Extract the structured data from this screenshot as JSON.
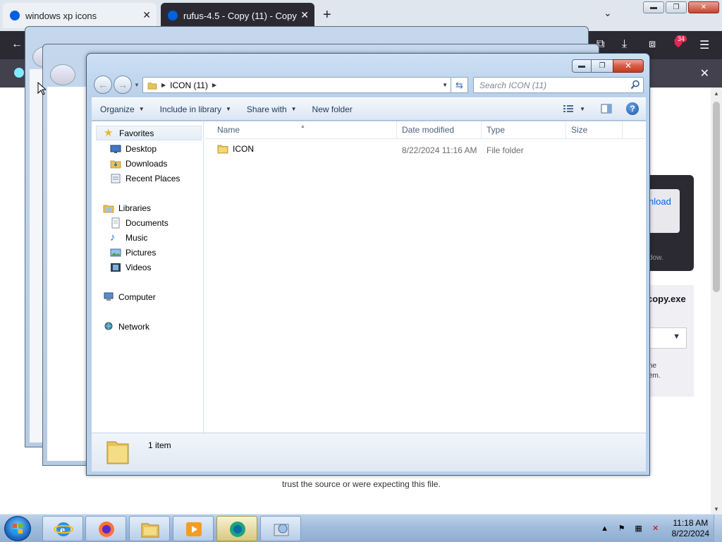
{
  "browser": {
    "tabs": [
      {
        "title": "windows xp icons",
        "close": "✕"
      },
      {
        "title": "rufus-4.5 - Copy (11) - Copy",
        "close": "✕"
      }
    ],
    "new_tab": "+",
    "tab_list": "⌄",
    "toolbar_icons": [
      "back-icon",
      "sync-icon",
      "download-icon",
      "extensions-icon",
      "ublock-icon",
      "menu-icon"
    ],
    "extension_badge": "34",
    "notification_close": "✕",
    "download_card_button": "nload",
    "download_card_note": "dow.",
    "exe_card_name": "copy.exe",
    "exe_card_text": "ne\nem.",
    "bottom_text": "trust the source or were expecting this file.",
    "window_buttons": {
      "minimize": "▬",
      "maximize": "❐",
      "close": "✕"
    }
  },
  "explorer": {
    "caption_buttons": {
      "minimize": "▬",
      "maximize": "❐",
      "close": "✕"
    },
    "address": {
      "crumb": "ICON (11)"
    },
    "search": {
      "placeholder": "Search ICON (11)"
    },
    "commands": [
      {
        "label": "Organize"
      },
      {
        "label": "Include in library"
      },
      {
        "label": "Share with"
      },
      {
        "label": "New folder"
      }
    ],
    "nav": {
      "favorites": {
        "label": "Favorites",
        "items": [
          "Desktop",
          "Downloads",
          "Recent Places"
        ]
      },
      "libraries": {
        "label": "Libraries",
        "items": [
          "Documents",
          "Music",
          "Pictures",
          "Videos"
        ]
      },
      "computer": "Computer",
      "network": "Network"
    },
    "columns": {
      "name": "Name",
      "date": "Date modified",
      "type": "Type",
      "size": "Size"
    },
    "files": [
      {
        "name": "ICON",
        "date": "8/22/2024 11:16 AM",
        "type": "File folder",
        "size": ""
      }
    ],
    "details": {
      "count": "1 item"
    }
  },
  "taskbar": {
    "apps": [
      "internet-explorer",
      "firefox",
      "windows-explorer",
      "media-player",
      "browser-app",
      "setup-app"
    ],
    "clock": {
      "time": "11:18 AM",
      "date": "8/22/2024"
    }
  },
  "colors": {
    "aero_frame": "#b9d1ea",
    "close_red": "#c43b22",
    "taskbar": "#9fbbdb",
    "firefox_dark": "#2b2a33"
  }
}
